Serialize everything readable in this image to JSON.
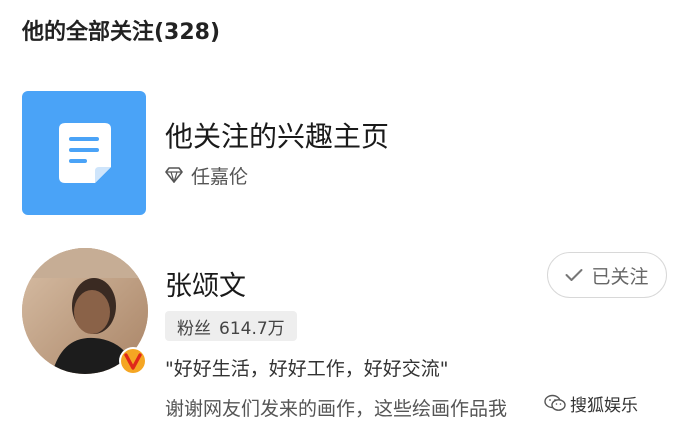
{
  "header": {
    "title": "他的全部关注(328)"
  },
  "interest_page": {
    "title": "他关注的兴趣主页",
    "owner": "任嘉伦",
    "icon": "document-icon",
    "owner_icon": "diamond-icon",
    "tile_color": "#4aa3f7"
  },
  "user": {
    "name": "张颂文",
    "follow_label": "已关注",
    "fans_label": "粉丝",
    "fans_count": "614.7万",
    "bio_line_1": "\"好好生活，好好工作，好好交流\"",
    "bio_line_2": "谢谢网友们发来的画作，这些绘画作品我",
    "verified_color": "#f5a623"
  },
  "watermark": {
    "text": "搜狐娱乐"
  }
}
